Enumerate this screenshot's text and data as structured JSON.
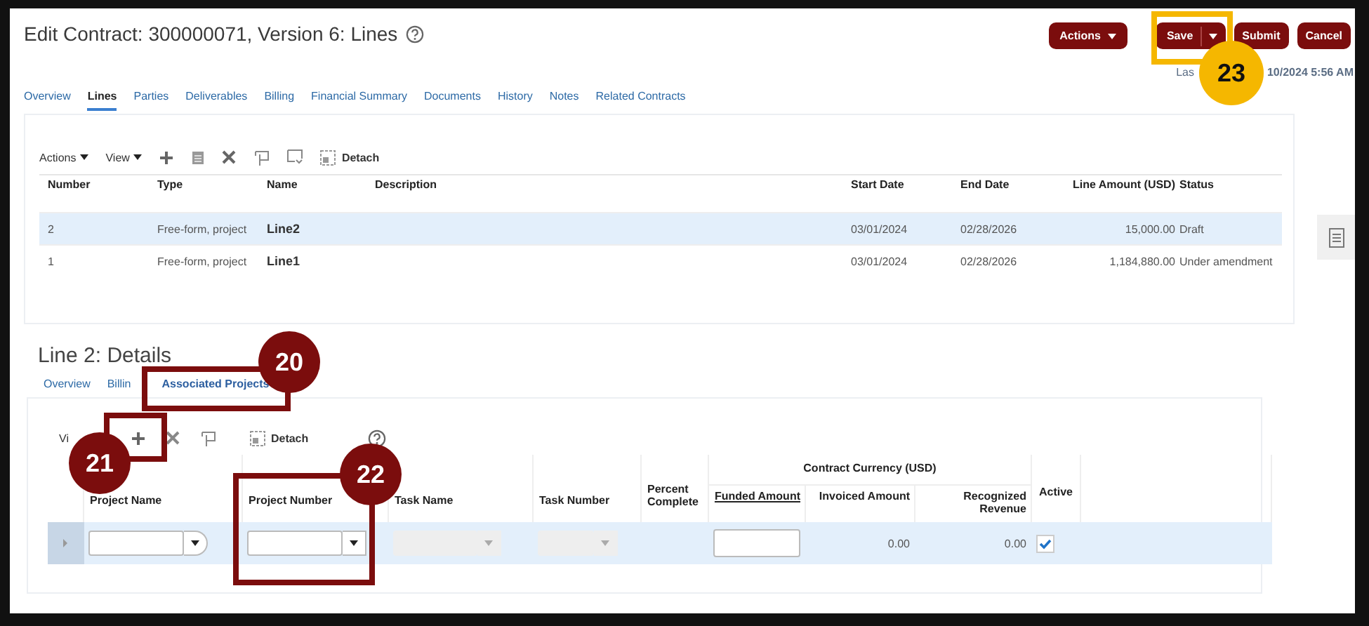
{
  "page": {
    "title": "Edit Contract: 300000071, Version 6: Lines"
  },
  "header_buttons": [
    {
      "label": "Actions",
      "kind": "menu"
    },
    {
      "label": "Save",
      "kind": "split"
    },
    {
      "label": "Submit",
      "kind": "plain"
    },
    {
      "label": "Cancel",
      "kind": "plain"
    }
  ],
  "last_updated": [
    "Las",
    "10/2024 5:56 AM"
  ],
  "tabs": [
    {
      "label": "Overview",
      "selected": false
    },
    {
      "label": "Lines",
      "selected": true
    },
    {
      "label": "Parties",
      "selected": false
    },
    {
      "label": "Deliverables",
      "selected": false
    },
    {
      "label": "Billing",
      "selected": false
    },
    {
      "label": "Financial Summary",
      "selected": false
    },
    {
      "label": "Documents",
      "selected": false
    },
    {
      "label": "History",
      "selected": false
    },
    {
      "label": "Notes",
      "selected": false
    },
    {
      "label": "Related Contracts",
      "selected": false
    }
  ],
  "lines_toolbar": {
    "menus": [
      "Actions",
      "View"
    ],
    "detach": "Detach"
  },
  "lines_table": {
    "columns": [
      "Number",
      "Type",
      "Name",
      "Description",
      "Start Date",
      "End Date",
      "Line Amount (USD)",
      "Status"
    ],
    "rows": [
      {
        "selected": true,
        "number": "2",
        "type": "Free-form, project",
        "name": "Line2",
        "start_date": "03/01/2024",
        "end_date": "02/28/2026",
        "amount": "15,000.00",
        "status": "Draft"
      },
      {
        "selected": false,
        "number": "1",
        "type": "Free-form, project",
        "name": "Line1",
        "start_date": "03/01/2024",
        "end_date": "02/28/2026",
        "amount": "1,184,880.00",
        "status": "Under amendment"
      }
    ]
  },
  "details": {
    "title": "Line 2: Details",
    "tabs": [
      {
        "label": "Overview",
        "selected": false
      },
      {
        "label": "Billin",
        "selected": false
      },
      {
        "label": "Associated Projects",
        "selected": true
      }
    ],
    "toolbar": {
      "view": "Vi",
      "detach": "Detach"
    },
    "table": {
      "columns": [
        "Project Name",
        "Project Number",
        "Task Name",
        "Task Number",
        "Percent Complete"
      ],
      "group_header": "Contract Currency (USD)",
      "amount_columns": [
        "Funded Amount",
        "Invoiced Amount",
        "Recognized Revenue"
      ],
      "active_column": "Active",
      "rows": [
        {
          "selected": true,
          "invoiced": "0.00",
          "recognized": "0.00",
          "active": true
        }
      ]
    }
  },
  "callouts": [
    {
      "number": "20",
      "color": "#7b0d0d"
    },
    {
      "number": "21",
      "color": "#7b0d0d"
    },
    {
      "number": "22",
      "color": "#7b0d0d"
    },
    {
      "number": "23",
      "color": "#f5b700"
    }
  ]
}
